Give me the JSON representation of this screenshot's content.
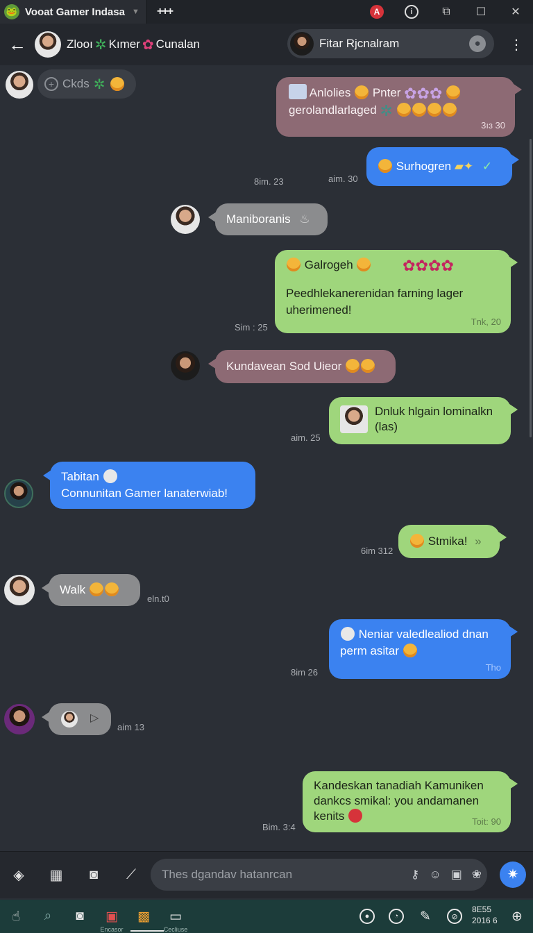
{
  "window": {
    "app_title": "Vooat Gamer Indasa",
    "new_tab_glyph": "+++",
    "red_badge": "A",
    "info_glyph": "i",
    "controls": [
      "⧉",
      "☐",
      "✕"
    ]
  },
  "header": {
    "back_glyph": "←",
    "group_name_1": "Zlooı",
    "group_name_2": "Kımer",
    "group_name_3": "Cunalan",
    "contact_name": "Fitar Rjcnalram",
    "more_glyph": "⋮"
  },
  "top_pill": {
    "label": "Ckds"
  },
  "messages": [
    {
      "line1": "Anlolies",
      "line1b": "Pnter",
      "line2": "gerolandlarlaged",
      "time": "3ıɜ 30"
    },
    {
      "text": "Surhogren",
      "left_time_1": "8im. 23",
      "left_time_2": "aim. 30"
    },
    {
      "text": "Maniboranis"
    },
    {
      "title": "Galrogeh",
      "body": "Peedhlekanerenidan farning lager uherimened!",
      "time": "Tnk, 20",
      "left_time": "Sim : 25"
    },
    {
      "text": "Kundavean Sod Uieor"
    },
    {
      "text": "Dnluk hlgain lominalkn (las)",
      "left_time": "aim. 25"
    },
    {
      "line1": "Tabitan",
      "line2": "Connunitan Gamer lanaterwiab!"
    },
    {
      "text": "Stmika!",
      "chev": "»",
      "left_time": "6im 312"
    },
    {
      "text": "Walk",
      "right_time": "eln.t0"
    },
    {
      "line1": "Neniar valedlealiod dnan",
      "line2": "perm asitar",
      "time": "Tho",
      "left_time": "8im 26"
    },
    {
      "right_time": "aim 13"
    },
    {
      "text": "Kandeskan tanadiah Kamuniken dankcs smikal: you andamanen kenits",
      "time": "Toit: 90",
      "left_time": "Bim. 3:4"
    }
  ],
  "composer": {
    "placeholder": "Thes dgandav hatanrcan"
  },
  "taskbar": {
    "label_1": "Encasor",
    "label_2": "Cecliuse",
    "clock_1": "8E55",
    "clock_2": "2016 6"
  },
  "colors": {
    "bg": "#2b2f36",
    "bubble_blue": "#3b82f0",
    "bubble_green": "#9fd67c",
    "bubble_mauve": "#8d6a74",
    "bubble_gray": "#8b8c8e"
  }
}
